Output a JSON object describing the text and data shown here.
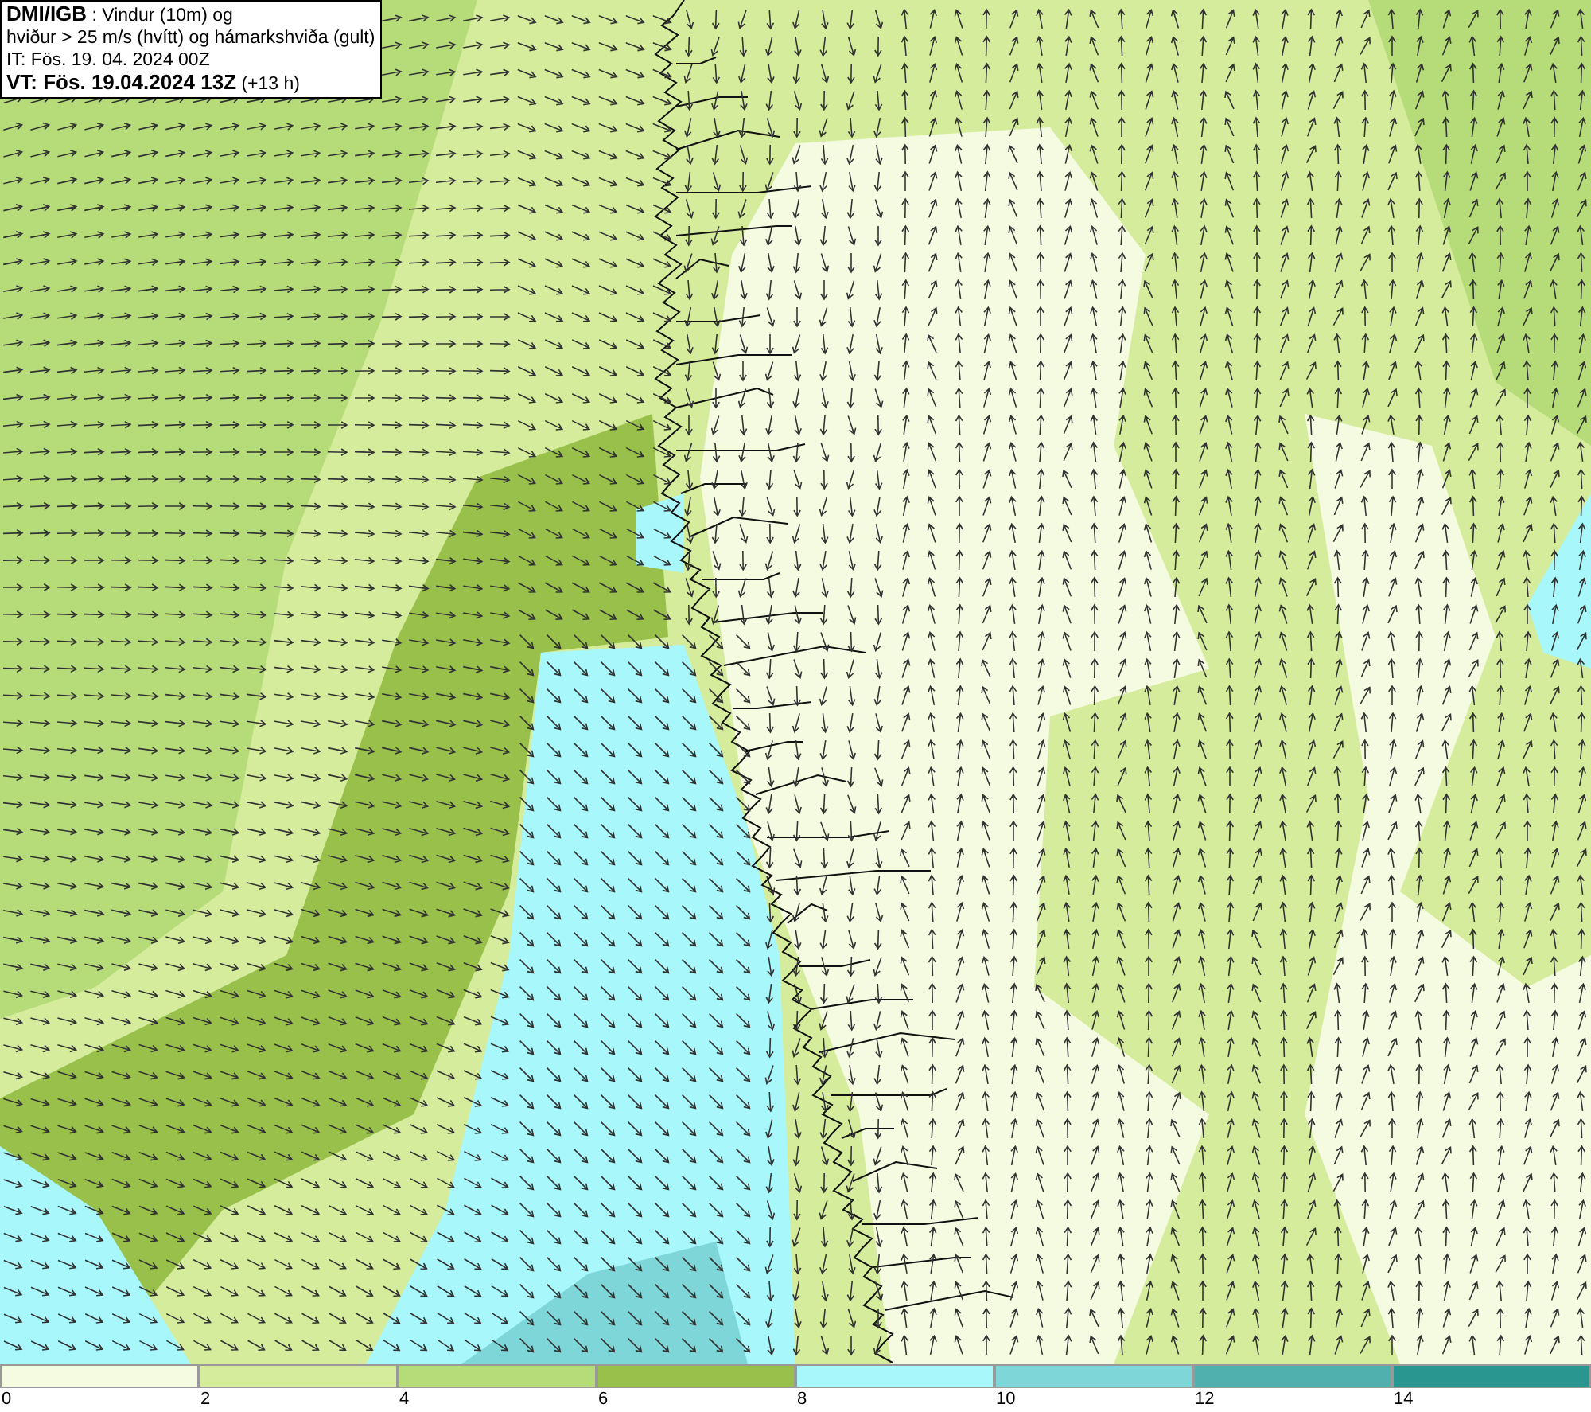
{
  "info_box": {
    "lines": [
      "**DMI/IGB** : Vindur (10m) og",
      "hviður > 25 m/s (hvítt) og hámarkshviða (gult)",
      "IT: Fös. 19. 04. 2024 00Z",
      "**VT: Fös. 19.04.2024 13Z** (+13 h)"
    ]
  },
  "legend": [
    {
      "label": "0",
      "color": "#f5fbe0"
    },
    {
      "label": "2",
      "color": "#d4ec9c"
    },
    {
      "label": "4",
      "color": "#b5dc78"
    },
    {
      "label": "6",
      "color": "#98c04a"
    },
    {
      "label": "8",
      "color": "#a8f8fb"
    },
    {
      "label": "10",
      "color": "#7ed6d8"
    },
    {
      "label": "12",
      "color": "#50b0ad"
    },
    {
      "label": "14",
      "color": "#2a9690"
    }
  ]
}
